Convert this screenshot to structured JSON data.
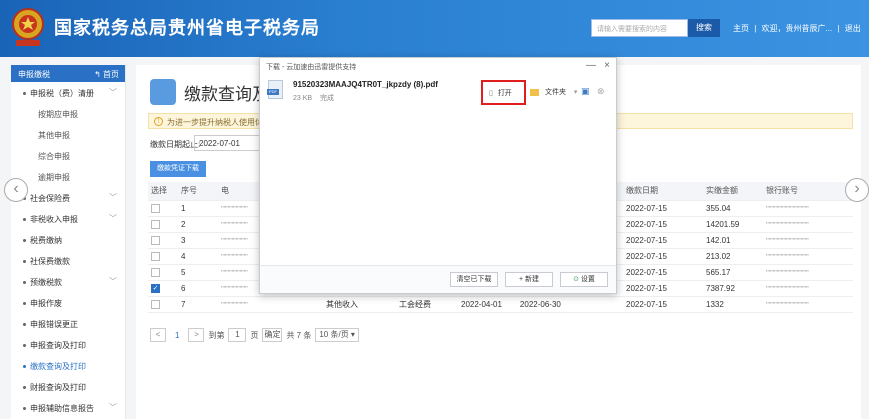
{
  "header": {
    "title": "国家税务总局贵州省电子税务局",
    "search_placeholder": "请输入需要搜索的内容",
    "search_button": "搜索",
    "links": [
      "主页",
      "|",
      "欢迎，贵州昔辰广...",
      "|",
      "退出"
    ]
  },
  "sidebar": {
    "head": "申报缴税",
    "home": "首页",
    "items": [
      {
        "label": "申报税（费）清册",
        "level": "top",
        "chevron": "﹀"
      },
      {
        "label": "按期应申报",
        "level": "sub"
      },
      {
        "label": "其他申报",
        "level": "sub"
      },
      {
        "label": "综合申报",
        "level": "sub"
      },
      {
        "label": "逾期申报",
        "level": "sub"
      },
      {
        "label": "社会保险费",
        "level": "top",
        "chevron": "﹀"
      },
      {
        "label": "非税收入申报",
        "level": "top",
        "chevron": "﹀"
      },
      {
        "label": "税费缴纳",
        "level": "top"
      },
      {
        "label": "社保费缴款",
        "level": "top"
      },
      {
        "label": "预缴税款",
        "level": "top",
        "chevron": "﹀"
      },
      {
        "label": "申报作废",
        "level": "top"
      },
      {
        "label": "申报错误更正",
        "level": "top"
      },
      {
        "label": "申报查询及打印",
        "level": "top"
      },
      {
        "label": "缴款查询及打印",
        "level": "top",
        "active": true
      },
      {
        "label": "财报查询及打印",
        "level": "top"
      },
      {
        "label": "申报辅助信息报告",
        "level": "top",
        "chevron": "﹀"
      }
    ]
  },
  "main": {
    "page_title": "缴款查询及打",
    "notice": "为进一步提升纳税人使用体验",
    "date_label": "缴款日期起止:",
    "date_value": "2022-07-01",
    "download_button": "缴款凭证下载",
    "table": {
      "headers": [
        "选择",
        "序号",
        "电",
        "",
        "",
        "缴款日期",
        "实缴金额",
        "银行账号"
      ],
      "rows": [
        {
          "checked": false,
          "no": "1",
          "c2": "''''''''''''''''''''",
          "c3": "",
          "c4": "",
          "date": "2022-07-15",
          "amount": "355.04",
          "account": "''''''''''''''''''''''''''''''''"
        },
        {
          "checked": false,
          "no": "2",
          "c2": "''''''''''''''''''''",
          "c3": "",
          "c4": "",
          "date": "2022-07-15",
          "amount": "14201.59",
          "account": "''''''''''''''''''''''''''''''''"
        },
        {
          "checked": false,
          "no": "3",
          "c2": "''''''''''''''''''''",
          "c3": "",
          "c4": "",
          "date": "2022-07-15",
          "amount": "142.01",
          "account": "''''''''''''''''''''''''''''''''"
        },
        {
          "checked": false,
          "no": "4",
          "c2": "''''''''''''''''''''",
          "c3": "",
          "c4": "",
          "date": "2022-07-15",
          "amount": "213.02",
          "account": "''''''''''''''''''''''''''''''''"
        },
        {
          "checked": false,
          "no": "5",
          "c2": "''''''''''''''''''''",
          "c3": "",
          "c4": "",
          "date": "2022-07-15",
          "amount": "565.17",
          "account": "''''''''''''''''''''''''''''''''"
        },
        {
          "checked": true,
          "no": "6",
          "c2": "''''''''''''''''''''",
          "c3": "",
          "c4": "",
          "date": "2022-07-15",
          "amount": "7387.92",
          "account": "''''''''''''''''''''''''''''''''"
        },
        {
          "checked": false,
          "no": "7",
          "c2": "''''''''''''''''''''",
          "c3": "其他收入",
          "c4": "工会经费",
          "c3b": "2022-04-01",
          "c4b": "2022-06-30",
          "date": "2022-07-15",
          "amount": "1332",
          "account": "''''''''''''''''''''''''''''''''"
        }
      ]
    },
    "pager": {
      "prev": "<",
      "page": "1",
      "next": ">",
      "goto": "到第",
      "goto_value": "1",
      "page_unit": "页",
      "confirm": "确定",
      "total": "共 7 条",
      "page_size": "10 条/页 ▾"
    }
  },
  "dialog": {
    "title": "下载 - 云加速由迅雷提供支持",
    "file_name": "91520323MAAJQ4TR0T_jkpzdy (8).pdf",
    "file_size": "23 KB",
    "file_status": "完成",
    "pdf_badge": "PDF",
    "open_label": "打开",
    "folder_label": "文件夹",
    "clear_label": "清空已下载",
    "new_label": "+  新建",
    "settings_label": "设置",
    "controls": [
      "—",
      "×"
    ]
  },
  "colors": {
    "header": "#2a7fd0",
    "accent": "#2a70c4",
    "highlight": "#e01e1e"
  }
}
